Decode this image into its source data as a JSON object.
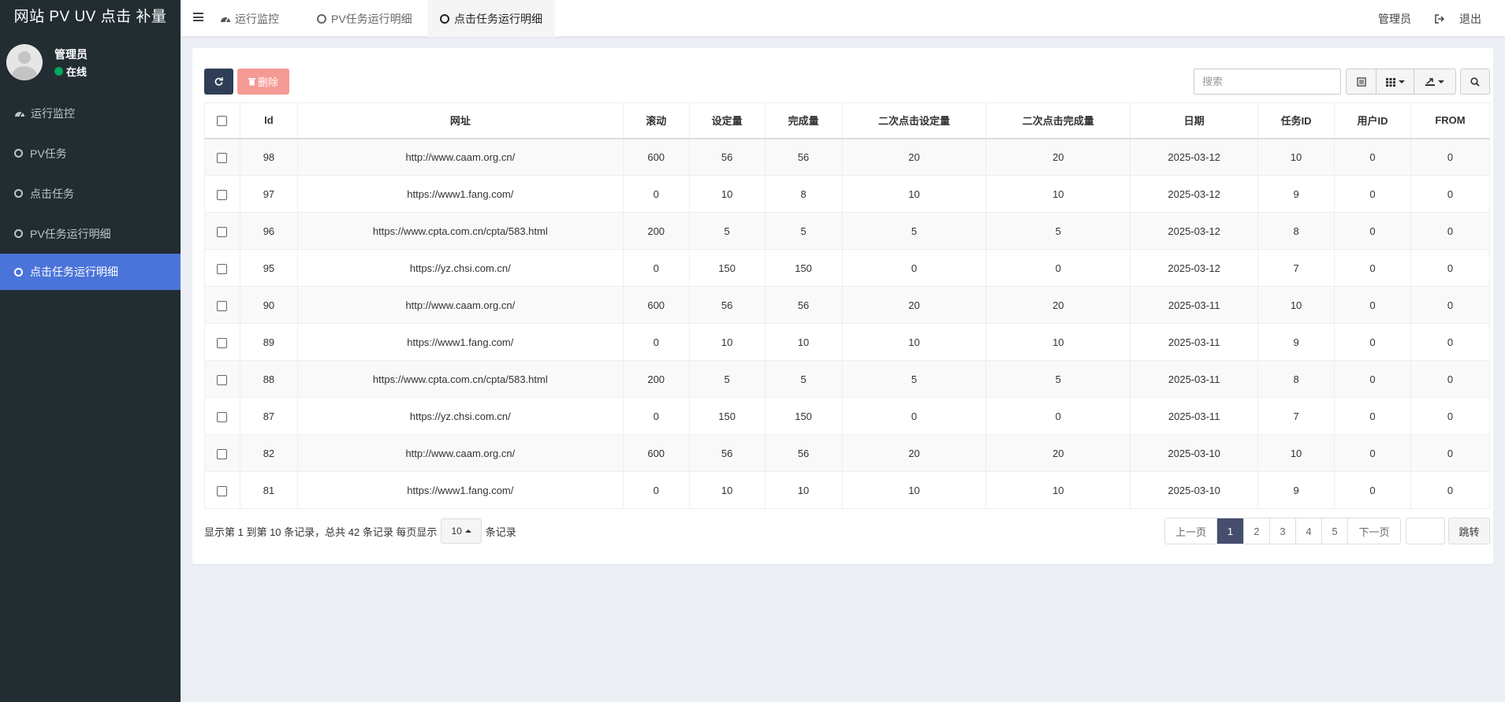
{
  "brand": "网站 PV UV 点击 补量",
  "user": {
    "name": "管理员",
    "status": "在线"
  },
  "sidebar": {
    "items": [
      {
        "label": "运行监控",
        "icon": "dashboard-icon"
      },
      {
        "label": "PV任务",
        "icon": "circle-icon"
      },
      {
        "label": "点击任务",
        "icon": "circle-icon"
      },
      {
        "label": "PV任务运行明细",
        "icon": "circle-icon"
      },
      {
        "label": "点击任务运行明细",
        "icon": "circle-icon",
        "active": true
      }
    ]
  },
  "topbar": {
    "tabs": [
      {
        "label": "运行监控",
        "icon": "dashboard-icon"
      },
      {
        "label": "PV任务运行明细",
        "icon": "circle-icon"
      },
      {
        "label": "点击任务运行明细",
        "icon": "circle-icon",
        "active": true
      }
    ],
    "user_label": "管理员",
    "logout_label": "退出"
  },
  "toolbar": {
    "delete_label": "删除",
    "search_placeholder": "搜索"
  },
  "table": {
    "headers": [
      "Id",
      "网址",
      "滚动",
      "设定量",
      "完成量",
      "二次点击设定量",
      "二次点击完成量",
      "日期",
      "任务ID",
      "用户ID",
      "FROM"
    ],
    "rows": [
      [
        "98",
        "http://www.caam.org.cn/",
        "600",
        "56",
        "56",
        "20",
        "20",
        "2025-03-12",
        "10",
        "0",
        "0"
      ],
      [
        "97",
        "https://www1.fang.com/",
        "0",
        "10",
        "8",
        "10",
        "10",
        "2025-03-12",
        "9",
        "0",
        "0"
      ],
      [
        "96",
        "https://www.cpta.com.cn/cpta/583.html",
        "200",
        "5",
        "5",
        "5",
        "5",
        "2025-03-12",
        "8",
        "0",
        "0"
      ],
      [
        "95",
        "https://yz.chsi.com.cn/",
        "0",
        "150",
        "150",
        "0",
        "0",
        "2025-03-12",
        "7",
        "0",
        "0"
      ],
      [
        "90",
        "http://www.caam.org.cn/",
        "600",
        "56",
        "56",
        "20",
        "20",
        "2025-03-11",
        "10",
        "0",
        "0"
      ],
      [
        "89",
        "https://www1.fang.com/",
        "0",
        "10",
        "10",
        "10",
        "10",
        "2025-03-11",
        "9",
        "0",
        "0"
      ],
      [
        "88",
        "https://www.cpta.com.cn/cpta/583.html",
        "200",
        "5",
        "5",
        "5",
        "5",
        "2025-03-11",
        "8",
        "0",
        "0"
      ],
      [
        "87",
        "https://yz.chsi.com.cn/",
        "0",
        "150",
        "150",
        "0",
        "0",
        "2025-03-11",
        "7",
        "0",
        "0"
      ],
      [
        "82",
        "http://www.caam.org.cn/",
        "600",
        "56",
        "56",
        "20",
        "20",
        "2025-03-10",
        "10",
        "0",
        "0"
      ],
      [
        "81",
        "https://www1.fang.com/",
        "0",
        "10",
        "10",
        "10",
        "10",
        "2025-03-10",
        "9",
        "0",
        "0"
      ]
    ]
  },
  "footer": {
    "info_text": "显示第 1 到第 10 条记录，总共 42 条记录 每页显示",
    "page_size": "10",
    "info_suffix": "条记录",
    "pagination": {
      "prev": "上一页",
      "pages": [
        "1",
        "2",
        "3",
        "4",
        "5"
      ],
      "current": "1",
      "next": "下一页",
      "jump": "跳转"
    }
  },
  "colors": {
    "sidebar_bg": "#222d32",
    "active_menu": "#4b74d9",
    "refresh_btn": "#2f3e56",
    "delete_btn": "#f59a94",
    "page_active": "#454e6e",
    "online": "#00a65a"
  }
}
